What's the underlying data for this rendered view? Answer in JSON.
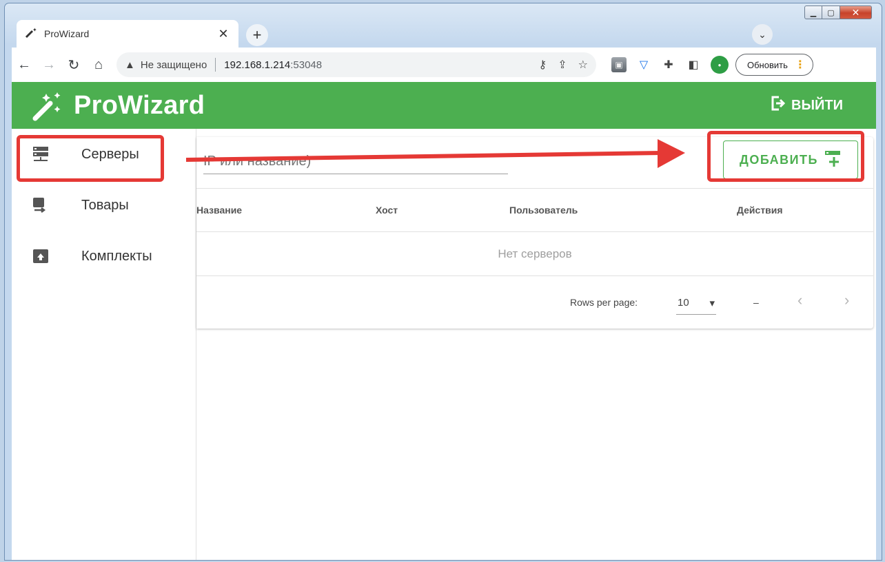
{
  "browser": {
    "tab_title": "ProWizard",
    "security_text": "Не защищено",
    "url_host": "192.168.1.214",
    "url_port": ":53048",
    "update_label": "Обновить"
  },
  "app": {
    "brand": "ProWizard",
    "logout_label": "ВЫЙТИ",
    "accent": "#4caf50",
    "sidebar": [
      {
        "label": "Серверы",
        "icon": "server-icon"
      },
      {
        "label": "Товары",
        "icon": "products-icon"
      },
      {
        "label": "Комплекты",
        "icon": "kit-icon"
      }
    ],
    "search": {
      "placeholder": "IP или название)"
    },
    "add_label": "ДОБАВИТЬ",
    "table": {
      "columns": [
        "Название",
        "Хост",
        "Пользователь",
        "Действия"
      ],
      "empty_text": "Нет серверов"
    },
    "pager": {
      "rows_label": "Rows per page:",
      "rows_value": "10",
      "range": "–"
    }
  },
  "annotation_color": "#e53935"
}
